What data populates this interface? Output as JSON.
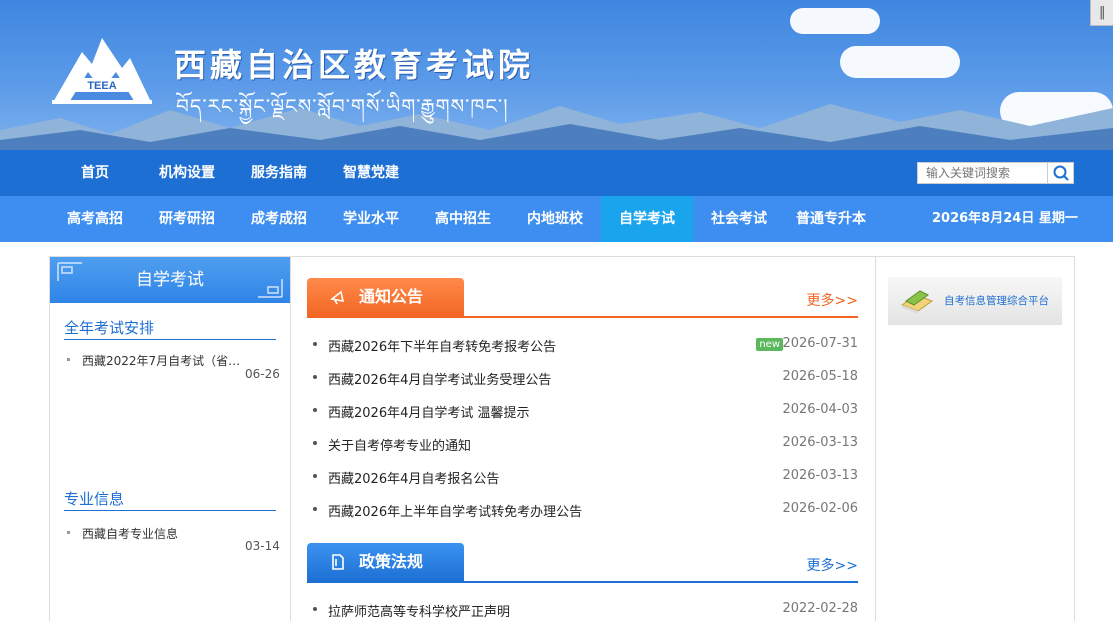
{
  "header": {
    "title": "西藏自治区教育考试院",
    "subtitle": "བོད་རང་སྐྱོང་ལྗོངས་སློབ་གསོ་ཡིག་རྒྱུགས་ཁང་།",
    "logo_text": "TEEA"
  },
  "nav_primary": [
    {
      "label": "首页"
    },
    {
      "label": "机构设置"
    },
    {
      "label": "服务指南"
    },
    {
      "label": "智慧党建"
    }
  ],
  "search": {
    "placeholder": "输入关键词搜索"
  },
  "nav_secondary": [
    {
      "label": "高考高招"
    },
    {
      "label": "研考研招"
    },
    {
      "label": "成考成招"
    },
    {
      "label": "学业水平"
    },
    {
      "label": "高中招生"
    },
    {
      "label": "内地班校"
    },
    {
      "label": "自学考试",
      "active": true
    },
    {
      "label": "社会考试"
    },
    {
      "label": "普通专升本"
    }
  ],
  "date": "2026年8月24日 星期一",
  "sidebar": {
    "header": "自学考试",
    "sections": [
      {
        "title": "全年考试安排",
        "items": [
          {
            "title": "西藏2022年7月自考试（省…",
            "date": "06-26"
          }
        ]
      },
      {
        "title": "专业信息",
        "items": [
          {
            "title": "西藏自考专业信息",
            "date": "03-14"
          }
        ]
      }
    ]
  },
  "notices": {
    "title": "通知公告",
    "more": "更多>>",
    "items": [
      {
        "title": "西藏2026年下半年自考转免考报考公告",
        "date": "2026-07-31",
        "badge": "new"
      },
      {
        "title": "西藏2026年4月自学考试业务受理公告",
        "date": "2026-05-18"
      },
      {
        "title": "西藏2026年4月自学考试 温馨提示",
        "date": "2026-04-03"
      },
      {
        "title": "关于自考停考专业的通知",
        "date": "2026-03-13"
      },
      {
        "title": "西藏2026年4月自考报名公告",
        "date": "2026-03-13"
      },
      {
        "title": "西藏2026年上半年自学考试转免考办理公告",
        "date": "2026-02-06"
      }
    ]
  },
  "policy": {
    "title": "政策法规",
    "more": "更多>>",
    "items": [
      {
        "title": "拉萨师范高等专科学校严正声明",
        "date": "2022-02-28"
      }
    ]
  },
  "right_panel": {
    "platform_label": "自考信息管理综合平台"
  },
  "colors": {
    "nav_primary": "#1d6fd3",
    "nav_secondary": "#3d8ef0",
    "active_tab": "#1aa4ee",
    "orange": "#f26522"
  }
}
